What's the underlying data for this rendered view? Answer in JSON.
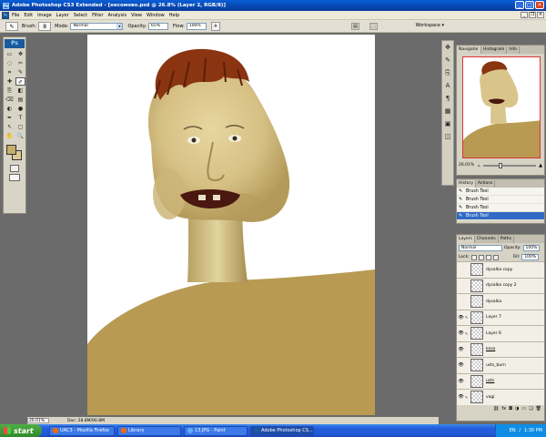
{
  "window": {
    "title": "Adobe Photoshop CS3 Extended - [несомово.psd @ 26.8% (Layer 2, RGB/8)]",
    "controls": {
      "minimize": "_",
      "maximize": "□",
      "close": "×"
    }
  },
  "menubar": {
    "ps_icon": "Ps",
    "items": [
      "File",
      "Edit",
      "Image",
      "Layer",
      "Select",
      "Filter",
      "Analysis",
      "View",
      "Window",
      "Help"
    ],
    "doc_controls": {
      "minimize": "_",
      "restore": "❐",
      "close": "×"
    }
  },
  "options_bar": {
    "brush_label": "Brush:",
    "brush_size": "8",
    "mode_label": "Mode:",
    "mode_value": "Normal",
    "opacity_label": "Opacity:",
    "opacity_value": "65%",
    "flow_label": "Flow:",
    "flow_value": "100%",
    "workspace_label": "Workspace ▾"
  },
  "toolbox": {
    "logo": "Ps",
    "tools": [
      "▭",
      "✥",
      "◌",
      "✂",
      "⌗",
      "✎",
      "✚",
      "✐",
      "⎘",
      "◧",
      "⌫",
      "▤",
      "◐",
      "●",
      "✒",
      "T",
      "↖",
      "▢",
      "✋",
      "🔍"
    ],
    "foreground_color": "#c6ad6c",
    "background_color": "#dec990"
  },
  "status_bar": {
    "zoom": "26.01%",
    "doc_info": "Doc: 28.8M/90.8M"
  },
  "navigator": {
    "tabs": [
      "Navigator",
      "Histogram",
      "Info"
    ],
    "zoom": "26.01%"
  },
  "history": {
    "tabs": [
      "History",
      "Actions"
    ],
    "items": [
      {
        "label": "Brush Tool",
        "active": false
      },
      {
        "label": "Brush Tool",
        "active": false
      },
      {
        "label": "Brush Tool",
        "active": false
      },
      {
        "label": "Brush Tool",
        "active": true
      }
    ]
  },
  "layers": {
    "tabs": [
      "Layers",
      "Channels",
      "Paths"
    ],
    "blend_mode": "Normal",
    "opacity_label": "Opacity:",
    "opacity_value": "100%",
    "lock_label": "Lock:",
    "fill_label": "Fill:",
    "fill_value": "100%",
    "items": [
      {
        "name": "dysalka copy",
        "visible": false,
        "active": false
      },
      {
        "name": "dysalka copy 2",
        "visible": false,
        "active": false
      },
      {
        "name": "dysalka",
        "visible": false,
        "active": false
      },
      {
        "name": "Layer 7",
        "visible": true,
        "active": false
      },
      {
        "name": "Layer 6",
        "visible": true,
        "active": false
      },
      {
        "name": "kosa",
        "visible": true,
        "active": false
      },
      {
        "name": "usts_burn",
        "visible": true,
        "active": false
      },
      {
        "name": "usts",
        "visible": true,
        "active": false
      },
      {
        "name": "vagi",
        "visible": true,
        "active": false
      }
    ]
  },
  "taskbar": {
    "start_label": "start",
    "tasks": [
      {
        "label": "UAC3 - Mozilla Firefox",
        "active": false
      },
      {
        "label": "Library",
        "active": false
      },
      {
        "label": "13.JPG - Paint",
        "active": false
      },
      {
        "label": "Adobe Photoshop CS...",
        "active": true
      }
    ],
    "language": "EN",
    "clock": "1:30 PM"
  },
  "colors": {
    "skin_body": "#b89a52",
    "hair": "#8a3412",
    "face": "#d9c58a",
    "selection_blue": "#316ac5"
  }
}
